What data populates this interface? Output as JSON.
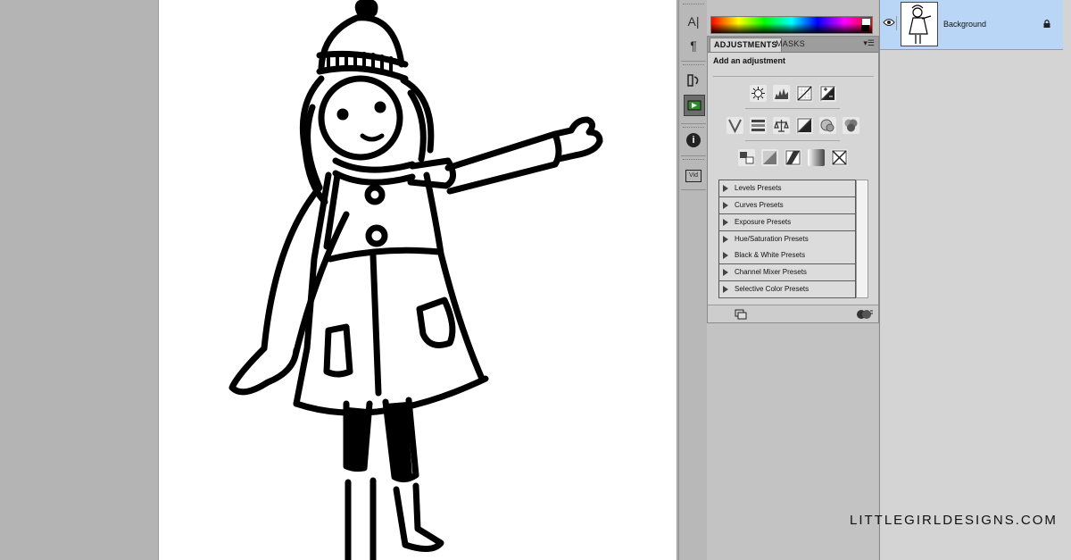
{
  "panel": {
    "tabs": [
      "ADJUSTMENTS",
      "MASKS"
    ],
    "title": "Add an adjustment",
    "presets": [
      "Levels Presets",
      "Curves Presets",
      "Exposure Presets",
      "Hue/Saturation Presets",
      "Black & White Presets",
      "Channel Mixer Presets",
      "Selective Color Presets"
    ]
  },
  "dock": {
    "text_tool_label": "A|",
    "paragraph_label": "¶",
    "info_label": "i",
    "video_label": "Vid"
  },
  "layers": {
    "row_name": "Background",
    "selected_color": "#b9d6f7"
  },
  "icons": {
    "adjustment_row1": [
      "brightness-contrast-icon",
      "levels-icon",
      "curves-icon",
      "exposure-icon"
    ],
    "adjustment_row2": [
      "vibrance-icon",
      "hue-saturation-icon",
      "color-balance-icon",
      "black-white-icon",
      "photo-filter-icon",
      "channel-mixer-icon"
    ],
    "adjustment_row3": [
      "invert-icon",
      "posterize-icon",
      "threshold-icon",
      "gradient-map-icon",
      "selective-color-icon"
    ]
  },
  "watermark": "LITTLEGIRLDESIGNS.COM"
}
